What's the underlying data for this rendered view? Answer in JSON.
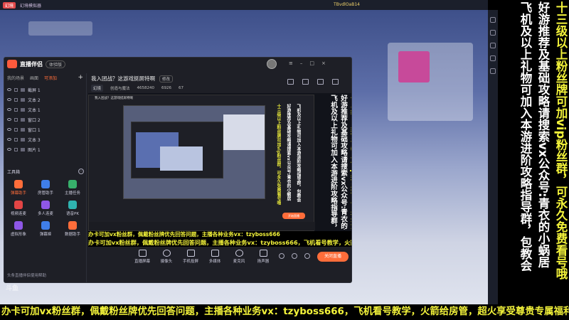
{
  "emulator": {
    "app_label": "幻境",
    "title": "幻境模拟器",
    "user_id": "TBvdlOaB14"
  },
  "right_banner": {
    "col1": "十三级以上粉丝牌可加vip粉丝群，可永久免费看号哦",
    "col2": "好游推荐及基础攻略请搜索vx公众号:青衣的小蜗居",
    "col3": "飞机及以上礼物可加入本游进阶攻略指导群，包教会"
  },
  "bottom_ticker": "办卡可加vx粉丝群，佩戴粉丝牌优先回答问题，主播各种业务vx：tzyboss666，飞机看号教学，火箭给房管，超火享受尊贵专属福利",
  "watermark": "斗鱼",
  "app": {
    "name": "直播伴侣",
    "version": "体验版",
    "tabs": [
      {
        "label": "我的场景"
      },
      {
        "label": "画面"
      },
      {
        "label": "可添加"
      }
    ],
    "add_symbol": "+",
    "scenes": [
      {
        "label": "截屏 1"
      },
      {
        "label": "文本 2"
      },
      {
        "label": "文本 1"
      },
      {
        "label": "窗口 2"
      },
      {
        "label": "窗口 1"
      },
      {
        "label": "文本 3"
      },
      {
        "label": "图片 1"
      }
    ],
    "tools_title": "工具箱",
    "tools_more": "···",
    "tools": [
      {
        "label": "弹幕助手",
        "color": "orange"
      },
      {
        "label": "房管助手",
        "color": "blue"
      },
      {
        "label": "主播任务",
        "color": "green"
      },
      {
        "label": "视频连麦",
        "color": "red"
      },
      {
        "label": "多人连麦",
        "color": "purple"
      },
      {
        "label": "语音PK",
        "color": "teal"
      },
      {
        "label": "虚拟形象",
        "color": "purple"
      },
      {
        "label": "弹幕姬",
        "color": "blue"
      },
      {
        "label": "数据助手",
        "color": "orange"
      }
    ],
    "footer": "头条直播伴侣使用帮助",
    "room_title": "我入团战？这游戏挺屌特啊",
    "edit_label": "修改",
    "room_tag": "幻境",
    "stats": {
      "game": "创造与魔法",
      "fans": "4658240",
      "likes": "6926",
      "viewers": "67"
    },
    "preview_v1": "十三级以上粉丝牌可加vip粉丝群，可永久免费看号哦",
    "preview_v2": "好游推荐及基础攻略请搜索vx公众号:青衣的小蜗居",
    "preview_v3": "飞机及以上礼物可加入本游进阶攻略指导群，包教会",
    "preview_ticker": "办卡可加vx粉丝群，佩戴粉丝牌优先回答问题，主播各种业务vx：tzyboss666，飞机看号教学，火箭给房管，超火享受尊贵专属福利",
    "mini_ticker": "办卡可加vx粉丝群，佩戴粉丝牌优先回答问题，主播各种业务vx：tzyboss666",
    "mini_header": "我入团战？这游戏挺屌特啊",
    "mini_live": "开始直播",
    "controls": [
      {
        "label": "直播屏幕"
      },
      {
        "label": "摄像头"
      },
      {
        "label": "手机投屏"
      },
      {
        "label": "多媒体"
      },
      {
        "label": "麦克风"
      },
      {
        "label": "扬声器"
      }
    ],
    "start_button": "关闭直播"
  }
}
